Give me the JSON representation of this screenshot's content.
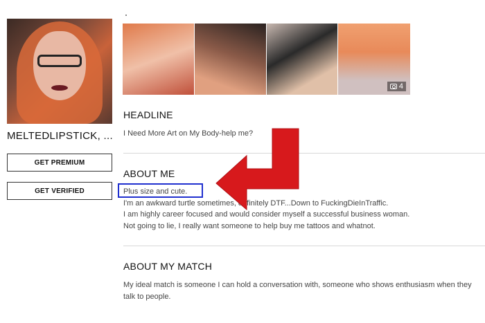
{
  "profile": {
    "username": "MELTEDLIPSTICK, ...",
    "premium_button": "GET PREMIUM",
    "verified_button": "GET VERIFIED"
  },
  "photos": {
    "count": "4"
  },
  "headline": {
    "title": "HEADLINE",
    "text": "I Need More Art on My Body-help me?"
  },
  "about_me": {
    "title": "ABOUT ME",
    "lines": [
      "Plus size and cute.",
      "I'm an awkward turtle sometimes, definitely DTF...Down to FuckingDieInTraffic.",
      "I am highly career focused and would consider myself a successful business woman.",
      "Not going to lie, I really want someone to help buy me tattoos and whatnot."
    ]
  },
  "about_match": {
    "title": "ABOUT MY MATCH",
    "lines": [
      "My ideal match is someone I can hold a conversation with, someone who shows enthusiasm when they",
      "talk to people."
    ]
  },
  "colors": {
    "arrow": "#d7191c",
    "highlight_box": "#1f2fcf"
  }
}
